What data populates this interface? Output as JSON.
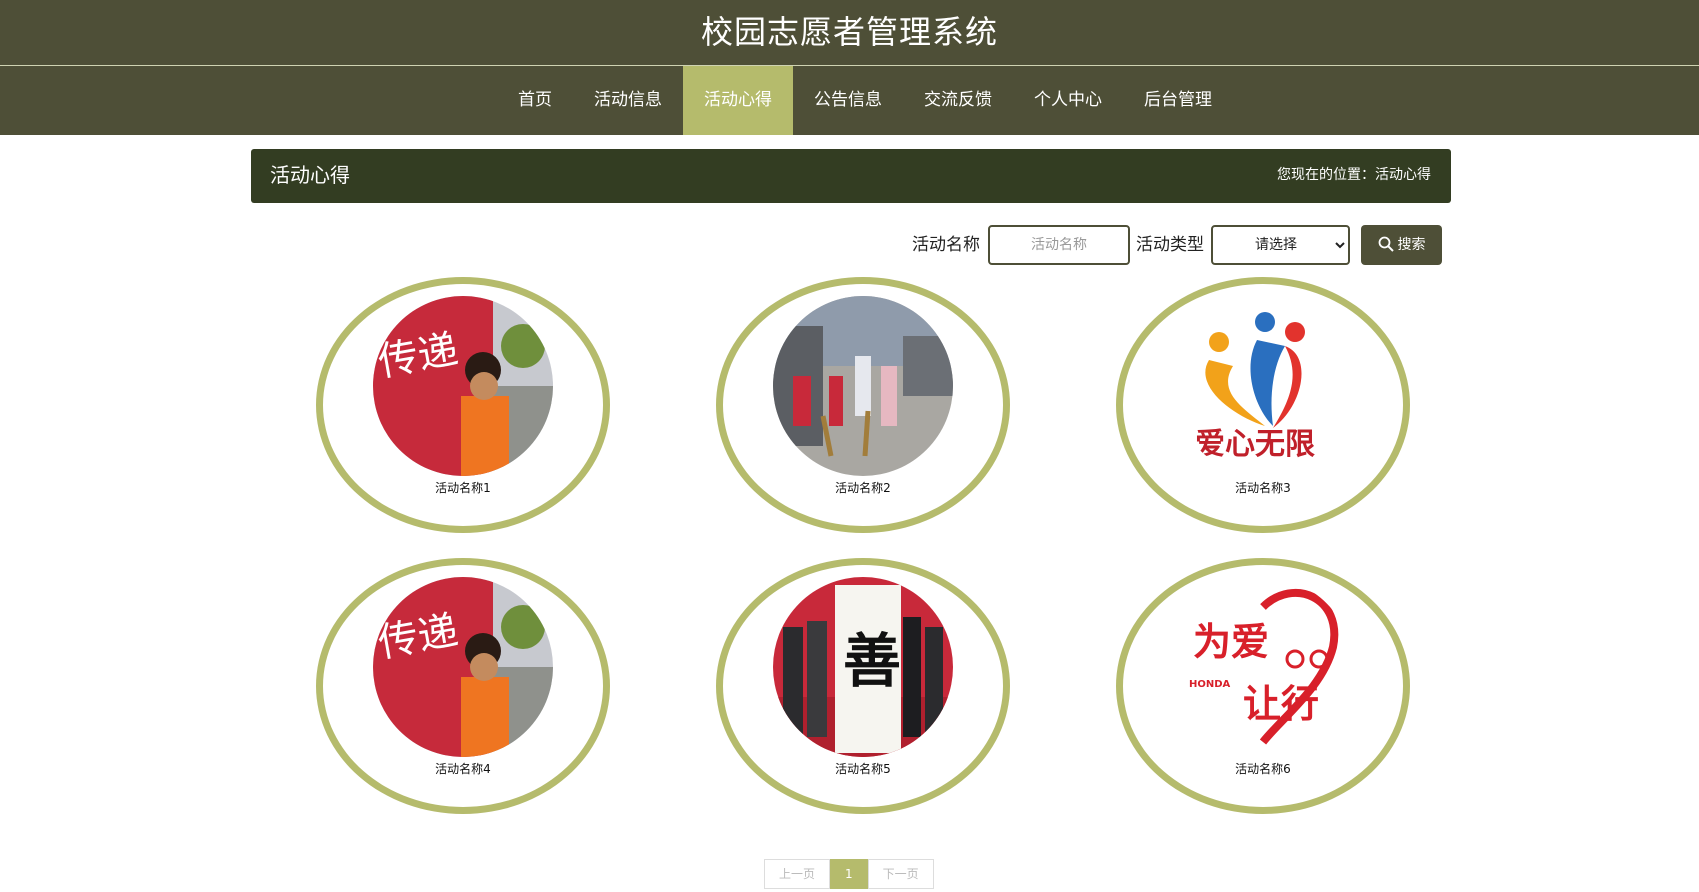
{
  "site": {
    "title": "校园志愿者管理系统"
  },
  "nav": [
    {
      "label": "首页",
      "active": false
    },
    {
      "label": "活动信息",
      "active": false
    },
    {
      "label": "活动心得",
      "active": true
    },
    {
      "label": "公告信息",
      "active": false
    },
    {
      "label": "交流反馈",
      "active": false
    },
    {
      "label": "个人中心",
      "active": false
    },
    {
      "label": "后台管理",
      "active": false
    }
  ],
  "section": {
    "title": "活动心得",
    "location_label": "您现在的位置：",
    "location_value": "活动心得"
  },
  "search": {
    "name_label": "活动名称",
    "name_placeholder": "活动名称",
    "type_label": "活动类型",
    "type_selected": "请选择",
    "button_label": "搜索"
  },
  "cards": [
    {
      "caption": "活动名称1"
    },
    {
      "caption": "活动名称2"
    },
    {
      "caption": "活动名称3"
    },
    {
      "caption": "活动名称4"
    },
    {
      "caption": "活动名称5"
    },
    {
      "caption": "活动名称6"
    }
  ],
  "pager": {
    "prev": "上一页",
    "current": "1",
    "next": "下一页"
  }
}
